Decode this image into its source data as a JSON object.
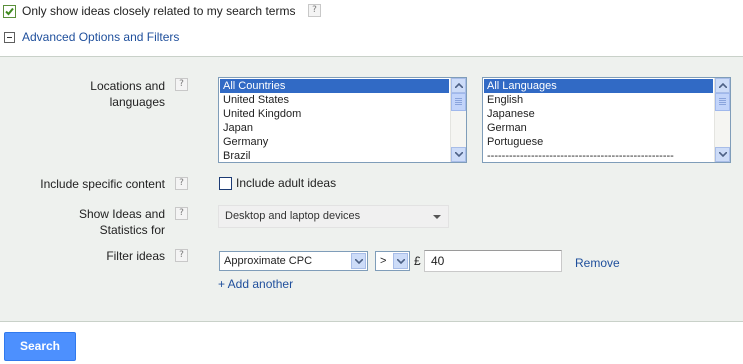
{
  "top": {
    "closely_related_label": "Only show ideas closely related to my search terms",
    "help_glyph": "?"
  },
  "advanced": {
    "toggle_label": "Advanced Options and Filters"
  },
  "locations": {
    "label_line1": "Locations and",
    "label_line2": "languages",
    "countries": [
      "All Countries",
      "United States",
      "United Kingdom",
      "Japan",
      "Germany",
      "Brazil"
    ],
    "languages": [
      "All Languages",
      "English",
      "Japanese",
      "German",
      "Portuguese",
      "---------------------------------------------------"
    ]
  },
  "content": {
    "label": "Include specific content",
    "adult_label": "Include adult ideas"
  },
  "devices": {
    "label_line1": "Show Ideas and",
    "label_line2": "Statistics for",
    "selected": "Desktop and laptop devices"
  },
  "filter": {
    "label": "Filter ideas",
    "metric": "Approximate CPC",
    "operator": ">",
    "currency": "£",
    "value": "40",
    "remove_label": "Remove",
    "add_another_label": "+ Add another"
  },
  "search_button_label": "Search",
  "colors": {
    "link": "#1f4f9c",
    "panel_bg": "#eef1ee",
    "selection": "#316ac5",
    "search_button": "#4d90fe"
  }
}
